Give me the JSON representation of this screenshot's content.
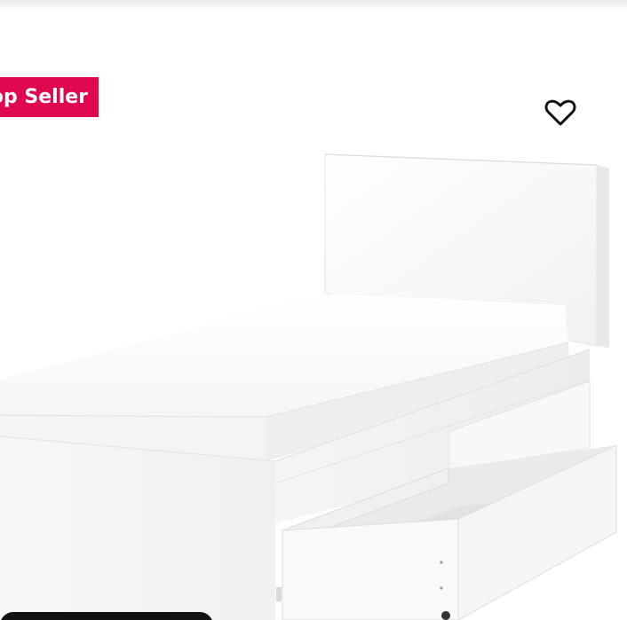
{
  "badge": {
    "label": "op Seller",
    "color": "#e00751"
  },
  "wishlist": {
    "icon": "heart-outline-icon"
  },
  "product_image": {
    "description": "bed-with-storage-drawers"
  }
}
